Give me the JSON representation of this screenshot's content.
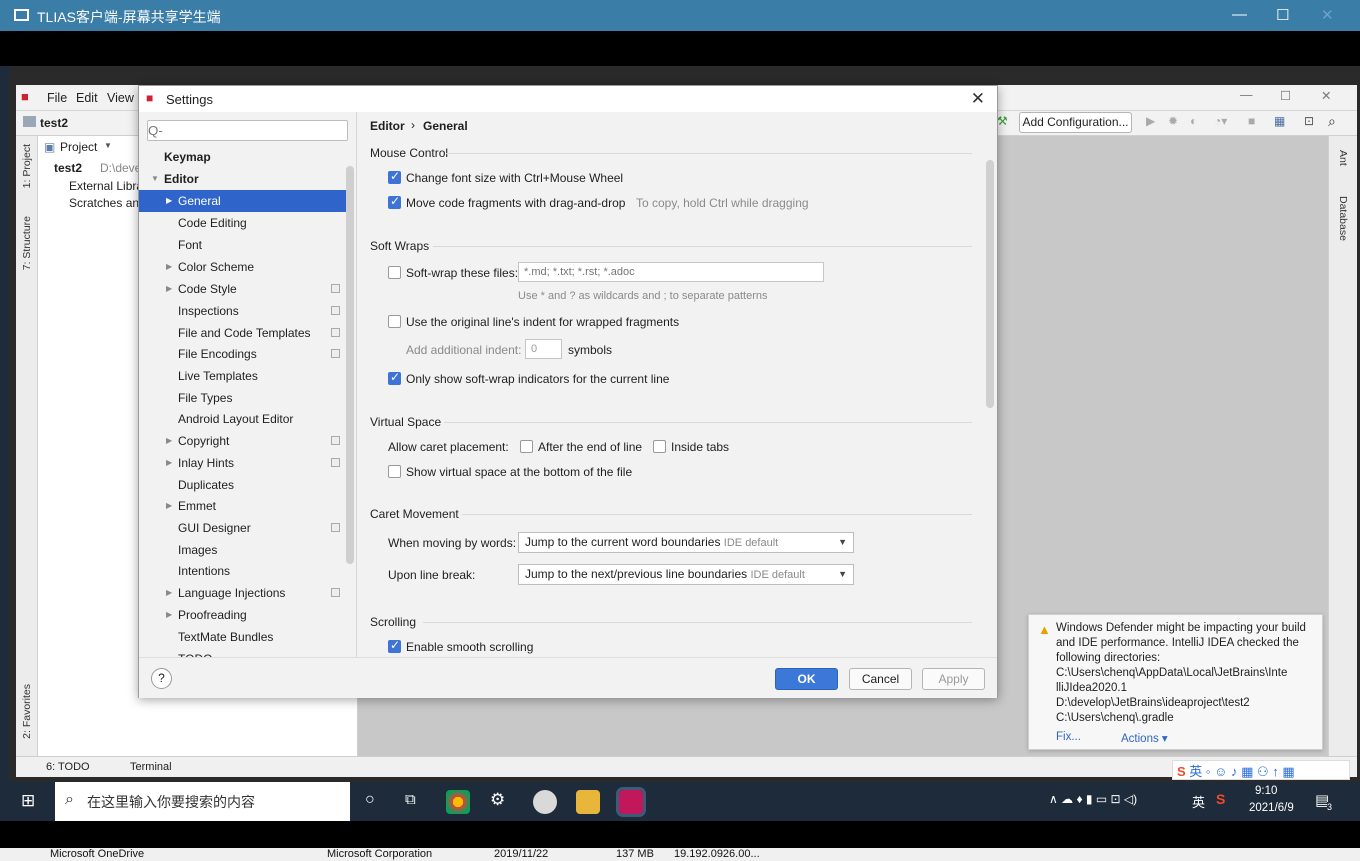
{
  "outer": {
    "title": "TLIAS客户端-屏幕共享学生端"
  },
  "ide": {
    "menu": [
      "File",
      "Edit",
      "View"
    ],
    "project_name": "test2",
    "panel_title": "Project",
    "tree": [
      {
        "label": "test2",
        "path": "D:\\deve"
      },
      {
        "label": "External Libra"
      },
      {
        "label": "Scratches anc"
      }
    ],
    "left_tabs": {
      "project": "1: Project",
      "structure": "7: Structure",
      "favorites": "2: Favorites"
    },
    "right_tabs": {
      "ant": "Ant",
      "database": "Database"
    },
    "add_config": "Add Configuration...",
    "bottom_tabs": {
      "todo": "6: TODO",
      "terminal": "Terminal"
    }
  },
  "dialog": {
    "title": "Settings",
    "search_placeholder": "Q-",
    "nav": [
      {
        "label": "Keymap"
      },
      {
        "label": "Editor"
      },
      {
        "label": "General"
      },
      {
        "label": "Code Editing"
      },
      {
        "label": "Font"
      },
      {
        "label": "Color Scheme"
      },
      {
        "label": "Code Style"
      },
      {
        "label": "Inspections"
      },
      {
        "label": "File and Code Templates"
      },
      {
        "label": "File Encodings"
      },
      {
        "label": "Live Templates"
      },
      {
        "label": "File Types"
      },
      {
        "label": "Android Layout Editor"
      },
      {
        "label": "Copyright"
      },
      {
        "label": "Inlay Hints"
      },
      {
        "label": "Duplicates"
      },
      {
        "label": "Emmet"
      },
      {
        "label": "GUI Designer"
      },
      {
        "label": "Images"
      },
      {
        "label": "Intentions"
      },
      {
        "label": "Language Injections"
      },
      {
        "label": "Proofreading"
      },
      {
        "label": "TextMate Bundles"
      },
      {
        "label": "TODO"
      }
    ],
    "breadcrumb": {
      "parent": "Editor",
      "sep": "›",
      "current": "General"
    },
    "sections": {
      "mouse": "Mouse Control",
      "soft": "Soft Wraps",
      "virtual": "Virtual Space",
      "caret": "Caret Movement",
      "scroll": "Scrolling"
    },
    "opts": {
      "font_wheel": "Change font size with Ctrl+Mouse Wheel",
      "drag_drop": "Move code fragments with drag-and-drop",
      "drag_hint": "To copy, hold Ctrl while dragging",
      "soft_wrap_files": "Soft-wrap these files:",
      "soft_wrap_placeholder": "*.md; *.txt; *.rst; *.adoc",
      "wildcard_hint": "Use * and ? as wildcards and ; to separate patterns",
      "orig_indent": "Use the original line's indent for wrapped fragments",
      "add_indent": "Add additional indent:",
      "indent_value": "0",
      "symbols": "symbols",
      "soft_indicators": "Only show soft-wrap indicators for the current line",
      "allow_caret": "Allow caret placement:",
      "after_end": "After the end of line",
      "inside_tabs": "Inside tabs",
      "virtual_bottom": "Show virtual space at the bottom of the file",
      "moving_words": "When moving by words:",
      "moving_words_val": "Jump to the current word boundaries",
      "line_break": "Upon line break:",
      "line_break_val": "Jump to the next/previous line boundaries",
      "ide_default": "IDE default",
      "smooth": "Enable smooth scrolling"
    },
    "buttons": {
      "ok": "OK",
      "cancel": "Cancel",
      "apply": "Apply",
      "help": "?"
    }
  },
  "notification": {
    "message": "Windows Defender might be impacting your build and IDE performance. IntelliJ IDEA checked the following directories:",
    "dirs": [
      "C:\\Users\\chenq\\AppData\\Local\\JetBrains\\Inte",
      "lliJIdea2020.1",
      "D:\\develop\\JetBrains\\ideaproject\\test2",
      "C:\\Users\\chenq\\.gradle"
    ],
    "fix": "Fix...",
    "actions": "Actions ▾"
  },
  "taskbar": {
    "search": "在这里输入你要搜索的内容",
    "time": "9:10",
    "date": "2021/6/9",
    "ime": "英",
    "notif_count": "3",
    "tray_ime": "英"
  },
  "under": {
    "cells": [
      "Microsoft OneDrive",
      "Microsoft Corporation",
      "2019/11/22",
      "137 MB",
      "19.192.0926.00..."
    ]
  }
}
